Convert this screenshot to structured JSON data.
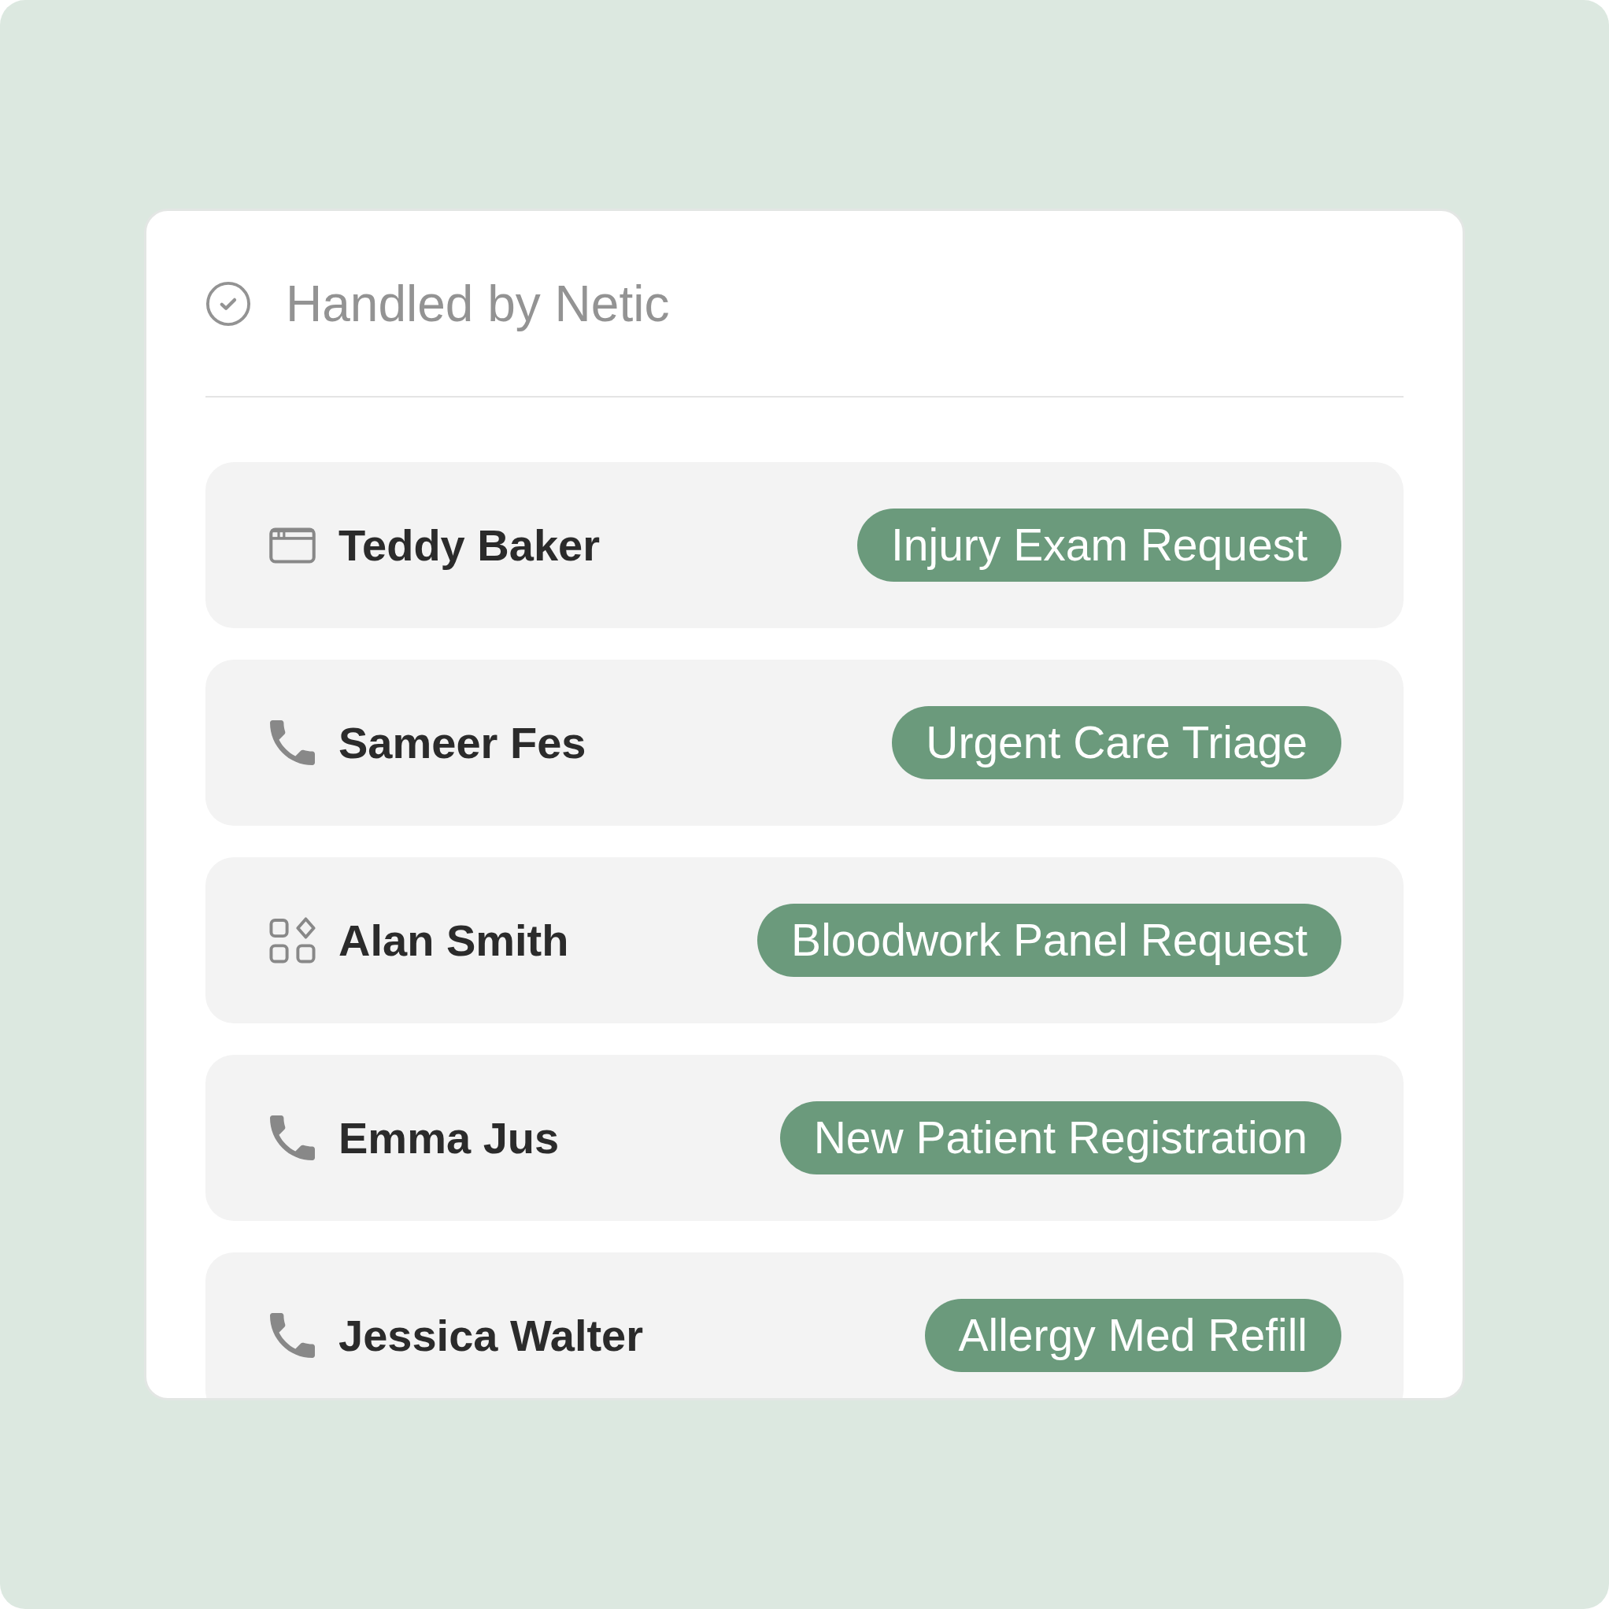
{
  "header": {
    "title": "Handled by Netic"
  },
  "requests": [
    {
      "kind": "web",
      "name": "Teddy Baker",
      "tag": "Injury Exam Request"
    },
    {
      "kind": "phone",
      "name": "Sameer Fes",
      "tag": "Urgent Care Triage"
    },
    {
      "kind": "apps",
      "name": "Alan Smith",
      "tag": "Bloodwork Panel Request"
    },
    {
      "kind": "phone",
      "name": "Emma Jus",
      "tag": "New Patient Registration"
    },
    {
      "kind": "phone",
      "name": "Jessica Walter",
      "tag": "Allergy Med Refill"
    }
  ]
}
